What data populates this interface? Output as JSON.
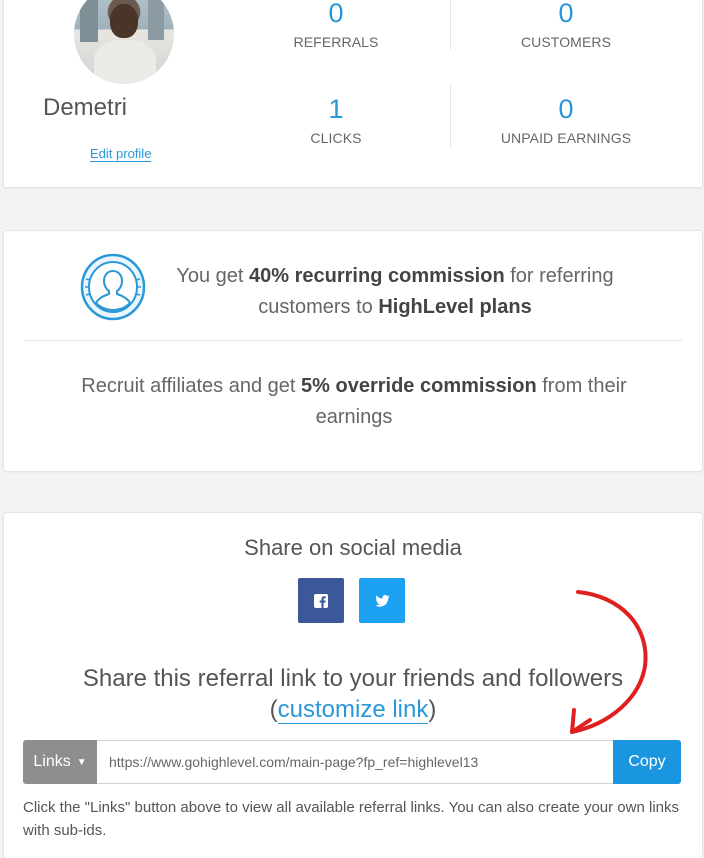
{
  "profile": {
    "name": "Demetri",
    "edit_label": "Edit profile"
  },
  "stats": [
    {
      "value": "0",
      "label": "REFERRALS"
    },
    {
      "value": "0",
      "label": "CUSTOMERS"
    },
    {
      "value": "1",
      "label": "CLICKS"
    },
    {
      "value": "0",
      "label": "UNPAID EARNINGS"
    }
  ],
  "commission": {
    "line1_pre": "You get ",
    "line1_bold": "40% recurring commission",
    "line1_mid": " for referring customers to ",
    "line1_bold2": "HighLevel plans",
    "line2_pre": "Recruit affiliates and get ",
    "line2_bold": "5% override commission",
    "line2_post": " from their earnings"
  },
  "share": {
    "title": "Share on social media",
    "facebook_icon": "facebook-icon",
    "twitter_icon": "twitter-icon",
    "referral_title": "Share this referral link to your friends and followers",
    "paren_open": "(",
    "customize_label": "customize link",
    "paren_close": ")",
    "links_label": "Links",
    "link_value": "https://www.gohighlevel.com/main-page?fp_ref=highlevel13",
    "copy_label": "Copy",
    "help_text": "Click the \"Links\" button above to view all available referral links. You can also create your own links with sub-ids."
  },
  "colors": {
    "accent": "#2a98d8",
    "facebook": "#3b5998",
    "twitter": "#1da1f2",
    "links_button": "#8e8e8e",
    "annotation_arrow": "#e02020"
  }
}
